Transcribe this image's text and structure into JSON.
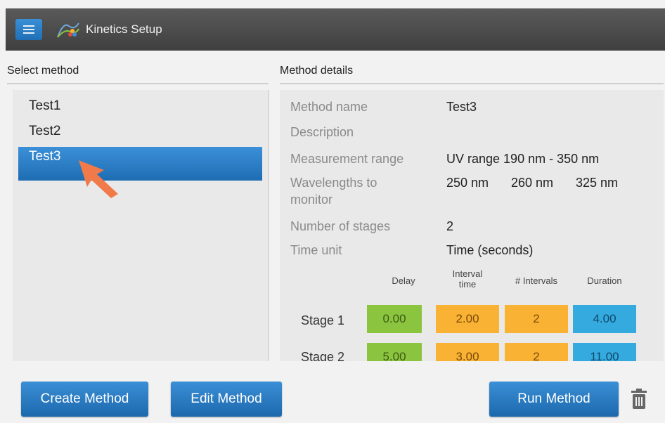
{
  "window": {
    "title": "Kinetics Setup"
  },
  "left": {
    "header": "Select method",
    "methods": [
      "Test1",
      "Test2",
      "Test3"
    ],
    "selected_index": 2
  },
  "right": {
    "header": "Method details",
    "fields": {
      "method_name_label": "Method name",
      "method_name_value": "Test3",
      "description_label": "Description",
      "measurement_range_label": "Measurement range",
      "measurement_range_value": "UV range 190 nm - 350 nm",
      "wavelengths_label_line1": "Wavelengths to",
      "wavelengths_label_line2": "monitor",
      "wavelengths": [
        "250 nm",
        "260 nm",
        "325 nm"
      ],
      "stages_label": "Number of stages",
      "stages_value": "2",
      "time_unit_label": "Time unit",
      "time_unit_value": "Time (seconds)"
    },
    "table": {
      "headers": {
        "delay": "Delay",
        "interval_line1": "Interval",
        "interval_line2": "time",
        "intervals": "# Intervals",
        "duration": "Duration"
      },
      "rows": [
        {
          "label": "Stage 1",
          "delay": "0.00",
          "interval": "2.00",
          "count": "2",
          "duration": "4.00"
        },
        {
          "label": "Stage 2",
          "delay": "5.00",
          "interval": "3.00",
          "count": "2",
          "duration": "11.00"
        }
      ]
    }
  },
  "buttons": {
    "create": "Create Method",
    "edit": "Edit Method",
    "run": "Run Method"
  },
  "icons": [
    "menu-icon",
    "kinetics-app-icon",
    "trash-icon",
    "pointer-arrow-icon"
  ],
  "colors": {
    "accent": "#1e6db3",
    "delay_cell": "#8bc53f",
    "interval_cell": "#f9b233",
    "duration_cell": "#35aadf"
  }
}
